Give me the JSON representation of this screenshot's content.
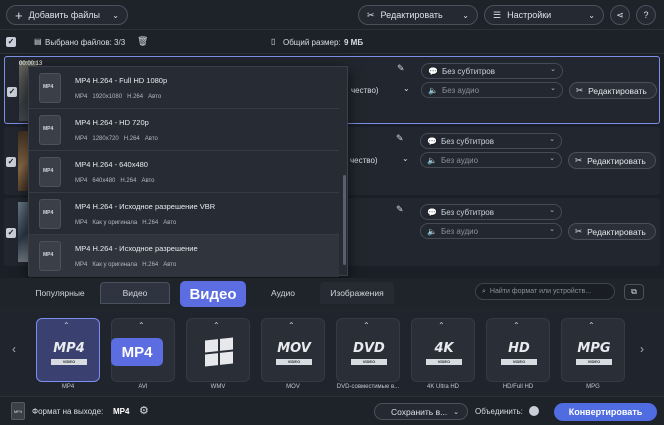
{
  "toolbar": {
    "add_files": "Добавить файлы",
    "edit": "Редактировать",
    "settings": "Настройки"
  },
  "selection": {
    "selected": "Выбрано файлов: 3/3",
    "total_label": "Общий размер:",
    "total_value": "9 МБ"
  },
  "file_rows": [
    {
      "duration": "00:00:13",
      "quality": "чество)",
      "subtitles": "Без субтитров",
      "audio": "Без аудио",
      "edit": "Редактировать"
    },
    {
      "quality": "чество)",
      "subtitles": "Без субтитров",
      "audio": "Без аудио",
      "edit": "Редактировать"
    },
    {
      "subtitles": "Без субтитров",
      "audio": "Без аудио",
      "edit": "Редактировать"
    }
  ],
  "preset_dropdown": [
    {
      "title": "MP4 H.264 - Full HD 1080p",
      "meta": [
        "MP4",
        "1920x1080",
        "H.264",
        "Авто"
      ]
    },
    {
      "title": "MP4 H.264 - HD 720p",
      "meta": [
        "MP4",
        "1280x720",
        "H.264",
        "Авто"
      ]
    },
    {
      "title": "MP4 H.264 - 640x480",
      "meta": [
        "MP4",
        "640x480",
        "H.264",
        "Авто"
      ]
    },
    {
      "title": "MP4 H.264 - Исходное разрешение VBR",
      "meta": [
        "MP4",
        "Как у оригинала",
        "H.264",
        "Авто"
      ]
    },
    {
      "title": "MP4 H.264 - Исходное разрешение",
      "meta": [
        "MP4",
        "Как у оригинала",
        "H.264",
        "Авто"
      ]
    }
  ],
  "tabs": [
    "Популярные",
    "Видео",
    "Аудио",
    "Изображения"
  ],
  "search_placeholder": "Найти формат или устройств...",
  "tooltips": {
    "video": "Видео",
    "mp4": "MP4"
  },
  "formats": [
    {
      "logo": "MP4",
      "sub": "VIDEO",
      "label": "MP4"
    },
    {
      "logo": "AVI",
      "sub": "",
      "label": "AVI"
    },
    {
      "logo": "WMV",
      "sub": "",
      "label": "WMV"
    },
    {
      "logo": "MOV",
      "sub": "VIDEO",
      "label": "MOV"
    },
    {
      "logo": "DVD",
      "sub": "VIDEO",
      "label": "DVD-совместимые в..."
    },
    {
      "logo": "4K",
      "sub": "VIDEO",
      "label": "4K Ultra HD"
    },
    {
      "logo": "HD",
      "sub": "VIDEO",
      "label": "HD/Full HD"
    },
    {
      "logo": "MPG",
      "sub": "VIDEO",
      "label": "MPG"
    }
  ],
  "bottom": {
    "output_label": "Формат на выходе:",
    "output_value": "MP4",
    "save": "Сохранить в...",
    "merge": "Объединить:",
    "convert": "Конвертировать"
  },
  "colors": {
    "accent": "#5b6de0",
    "convert": "#4f6ce0"
  }
}
